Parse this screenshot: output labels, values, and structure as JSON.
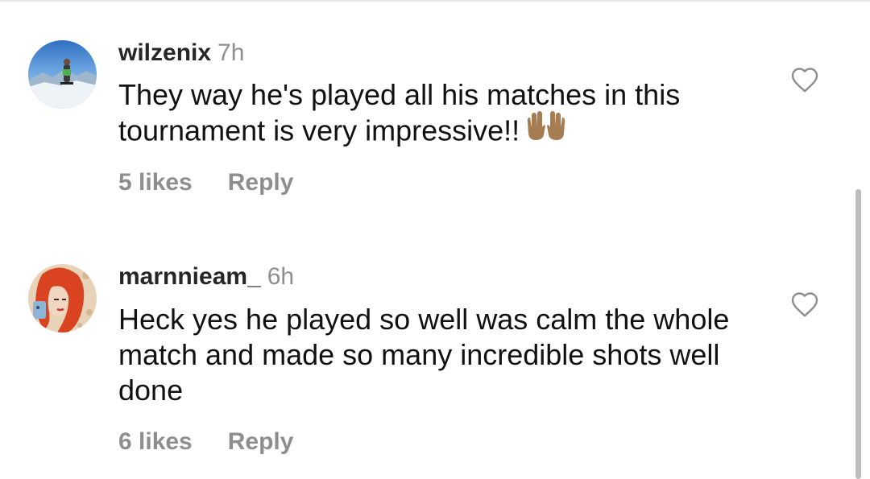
{
  "comments": [
    {
      "username": "wilzenix",
      "time": "7h",
      "text": "They way he's played all his matches in this tournament is very impressive!!",
      "emoji": "raising-hands",
      "likes": "5 likes",
      "reply": "Reply"
    },
    {
      "username": "marnnieam_",
      "time": "6h",
      "text": "Heck yes he played so well was calm the whole match and made so many incredible shots well done",
      "likes": "6 likes",
      "reply": "Reply"
    }
  ],
  "colors": {
    "username": "#262626",
    "text": "#111111",
    "secondary": "#8e8e8e",
    "scrollbar": "#bdbdbd"
  },
  "icons": {
    "like": "heart-outline-icon"
  }
}
